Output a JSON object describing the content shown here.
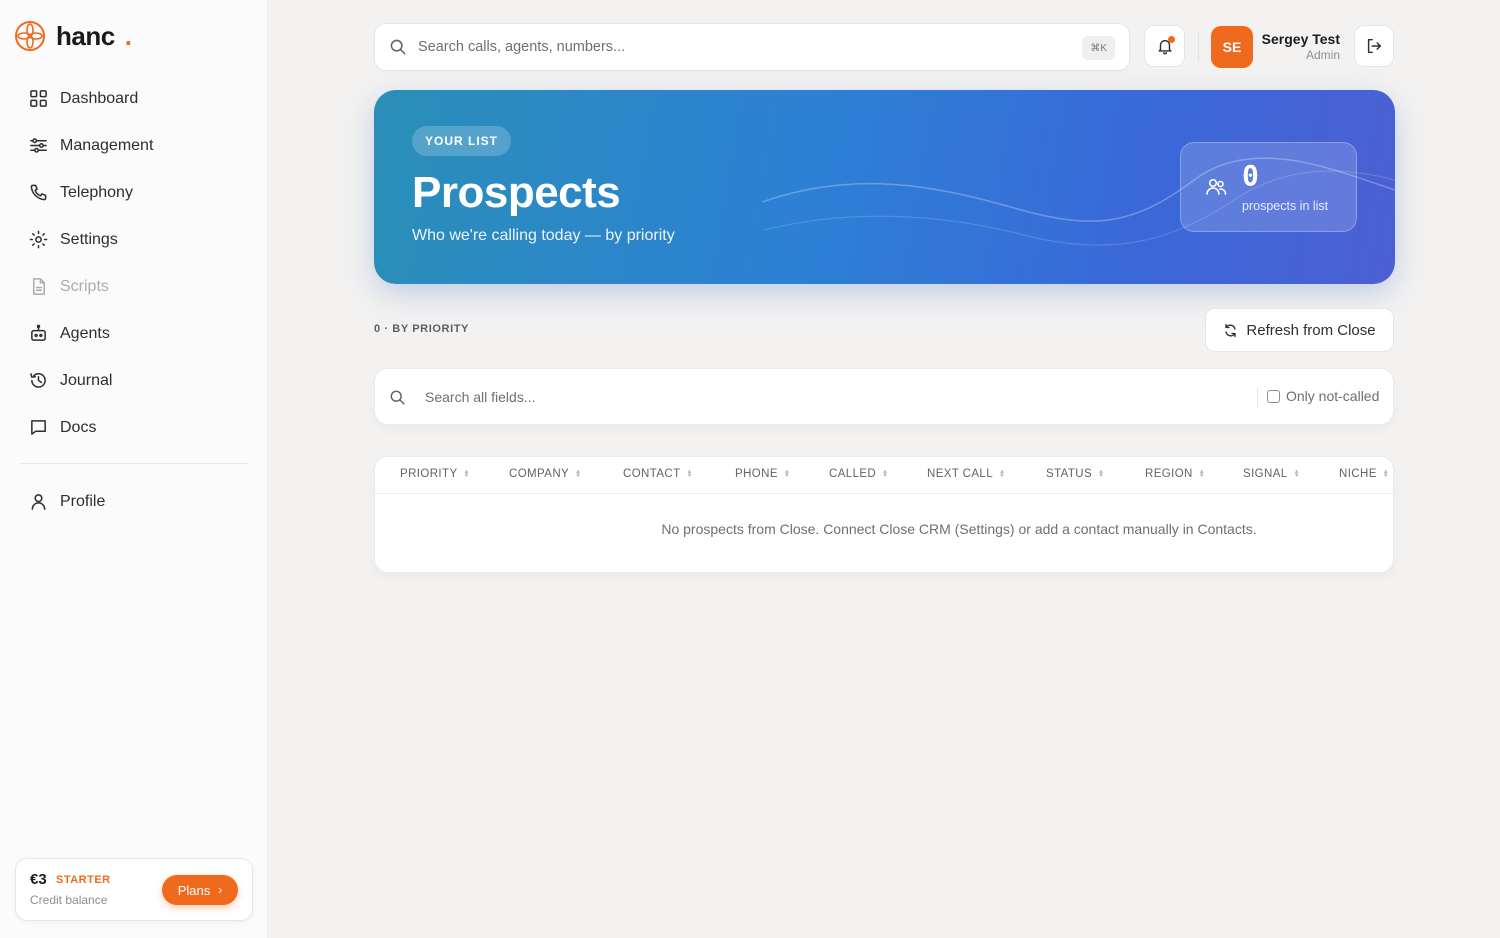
{
  "brand": {
    "name": "hanc",
    "dot": "."
  },
  "sidebar": {
    "items": [
      {
        "label": "Dashboard",
        "icon": "grid-icon"
      },
      {
        "label": "Management",
        "icon": "sliders-icon"
      },
      {
        "label": "Telephony",
        "icon": "phone-icon"
      },
      {
        "label": "Settings",
        "icon": "gear-icon"
      },
      {
        "label": "Scripts",
        "icon": "document-icon",
        "disabled": true
      },
      {
        "label": "Agents",
        "icon": "robot-icon"
      },
      {
        "label": "Journal",
        "icon": "history-icon"
      },
      {
        "label": "Docs",
        "icon": "chat-icon"
      }
    ],
    "profile": {
      "label": "Profile",
      "icon": "user-icon"
    },
    "credit": {
      "amount": "€3",
      "plan": "STARTER",
      "label": "Credit balance",
      "button": "Plans"
    }
  },
  "topbar": {
    "search_placeholder": "Search calls, agents, numbers...",
    "shortcut": "⌘K",
    "user": {
      "initials": "SE",
      "name": "Sergey Test",
      "role": "Admin"
    }
  },
  "hero": {
    "badge": "YOUR LIST",
    "title": "Prospects",
    "subtitle": "Who we're calling today — by priority",
    "stat_value": "0",
    "stat_label": "prospects in list"
  },
  "section": {
    "label": "0 · BY PRIORITY",
    "refresh": "Refresh from Close"
  },
  "filter": {
    "placeholder": "Search all fields...",
    "only_not_called": "Only not-called"
  },
  "table": {
    "columns": [
      "PRIORITY",
      "COMPANY",
      "CONTACT",
      "PHONE",
      "CALLED",
      "NEXT CALL",
      "STATUS",
      "REGION",
      "SIGNAL",
      "NICHE"
    ],
    "empty_message": "No prospects from Close. Connect Close CRM (Settings) or add a contact manually in Contacts."
  },
  "colors": {
    "accent": "#f06a1d",
    "hero_start": "#2a8fb8",
    "hero_end": "#4c5fd2"
  }
}
